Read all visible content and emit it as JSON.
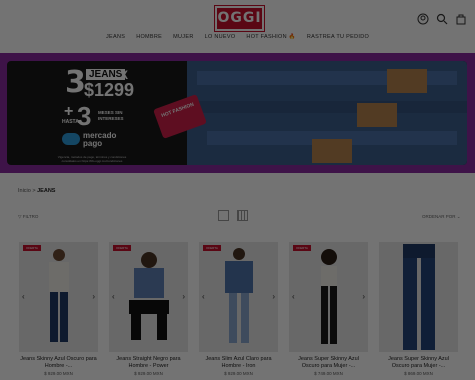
{
  "header": {
    "logo": "OGGI",
    "nav": [
      "JEANS",
      "HOMBRE",
      "MUJER",
      "LO NUEVO",
      "HOT FASHION 🔥",
      "RASTREA TU PEDIDO"
    ]
  },
  "banner": {
    "line1_count": "3",
    "line1_word": "JEANS",
    "line1_x": "X",
    "line1_price": "$1299",
    "line2_plus": "+",
    "line2_hasta": "HASTA",
    "line2_count": "3",
    "line2_text": "MESES SIN INTERESES",
    "payment_brand": "mercado pago",
    "badge": "HOT FASHION",
    "fineprint": "Vigencia, métodos de pago, términos y condiciones consúltalos en https://lifo.oggi.mx/condiciones"
  },
  "breadcrumb": {
    "home": "Inicio",
    "sep": ">",
    "current": "JEANS"
  },
  "toolbar": {
    "filter": "FILTRO",
    "sort": "ORDENAR POR"
  },
  "products": [
    {
      "name": "Jeans Skinny Azul Oscuro para Hombre -...",
      "price": "$ 929.00 MXN",
      "tag": "OFERTA"
    },
    {
      "name": "Jeans Straight Negro para Hombre - Power",
      "price": "$ 929.00 MXN",
      "tag": "OFERTA"
    },
    {
      "name": "Jeans Slim Azul Claro para Hombre - Iron",
      "price": "$ 929.00 MXN",
      "tag": "OFERTA"
    },
    {
      "name": "Jeans Super Skinny Azul Oscuro para Mujer -...",
      "price": "$ 749.00 MXN",
      "tag": "OFERTA"
    },
    {
      "name": "Jeans Super Skinny Azul Oscuro para Mujer -...",
      "price": "$ 869.00 MXN",
      "tag": ""
    }
  ],
  "colors": {
    "brand": "#c8102e",
    "banner_border": "#8a2aa0"
  }
}
